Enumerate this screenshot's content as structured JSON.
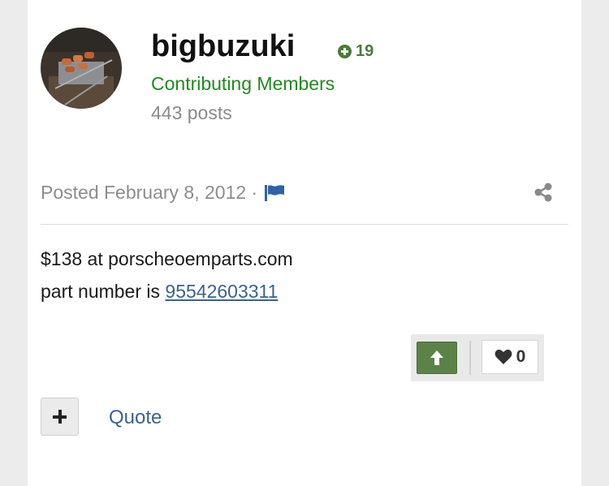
{
  "author": {
    "username": "bigbuzuki",
    "reputation": "19",
    "group": "Contributing Members",
    "posts": "443 posts"
  },
  "post": {
    "posted_prefix": "Posted February 8, 2012 ·",
    "content_line1": "$138 at porscheoemparts.com",
    "content_line2_prefix": "part number is ",
    "part_number_link": "95542603311"
  },
  "reactions": {
    "like_count": "0"
  },
  "actions": {
    "quote_label": "Quote"
  },
  "colors": {
    "rep_green": "#4b7a3b",
    "group_green": "#1f8a1f",
    "link_blue": "#38648f",
    "upvote_green": "#5c8249"
  },
  "icons": [
    "plus-circle-icon",
    "flag-icon",
    "share-icon",
    "arrow-up-icon",
    "heart-icon",
    "plus-icon"
  ]
}
